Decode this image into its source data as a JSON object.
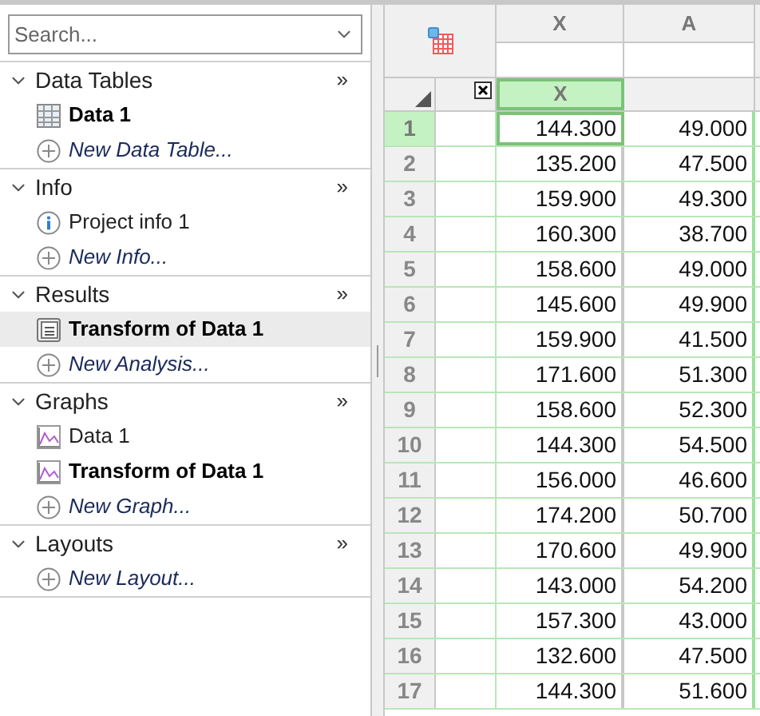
{
  "search": {
    "placeholder": "Search..."
  },
  "sections": [
    {
      "title": "Data Tables",
      "more": "»",
      "expanded": true,
      "items": [
        {
          "kind": "table",
          "label": "Data 1",
          "active": true,
          "selected": false
        },
        {
          "kind": "new",
          "label": "New Data Table...",
          "active": false,
          "selected": false
        }
      ]
    },
    {
      "title": "Info",
      "more": "»",
      "expanded": true,
      "items": [
        {
          "kind": "info",
          "label": "Project info 1",
          "active": false,
          "selected": false
        },
        {
          "kind": "new",
          "label": "New Info...",
          "active": false,
          "selected": false
        }
      ]
    },
    {
      "title": "Results",
      "more": "»",
      "expanded": true,
      "items": [
        {
          "kind": "result",
          "label": "Transform of Data 1",
          "active": true,
          "selected": true
        },
        {
          "kind": "new",
          "label": "New Analysis...",
          "active": false,
          "selected": false
        }
      ]
    },
    {
      "title": "Graphs",
      "more": "»",
      "expanded": true,
      "items": [
        {
          "kind": "graph",
          "label": "Data 1",
          "active": false,
          "selected": false
        },
        {
          "kind": "graph",
          "label": "Transform of Data 1",
          "active": true,
          "selected": false
        },
        {
          "kind": "new",
          "label": "New Graph...",
          "active": false,
          "selected": false
        }
      ]
    },
    {
      "title": "Layouts",
      "more": "»",
      "expanded": true,
      "items": [
        {
          "kind": "new",
          "label": "New Layout...",
          "active": false,
          "selected": false
        }
      ]
    }
  ],
  "grid": {
    "columns": [
      {
        "letter": "X",
        "title": "X",
        "selected": true
      },
      {
        "letter": "A",
        "selected": false
      }
    ],
    "rows": [
      {
        "num": "1",
        "selected": true,
        "cells": [
          "144.300",
          "49.000"
        ]
      },
      {
        "num": "2",
        "selected": false,
        "cells": [
          "135.200",
          "47.500"
        ]
      },
      {
        "num": "3",
        "selected": false,
        "cells": [
          "159.900",
          "49.300"
        ]
      },
      {
        "num": "4",
        "selected": false,
        "cells": [
          "160.300",
          "38.700"
        ]
      },
      {
        "num": "5",
        "selected": false,
        "cells": [
          "158.600",
          "49.000"
        ]
      },
      {
        "num": "6",
        "selected": false,
        "cells": [
          "145.600",
          "49.900"
        ]
      },
      {
        "num": "7",
        "selected": false,
        "cells": [
          "159.900",
          "41.500"
        ]
      },
      {
        "num": "8",
        "selected": false,
        "cells": [
          "171.600",
          "51.300"
        ]
      },
      {
        "num": "9",
        "selected": false,
        "cells": [
          "158.600",
          "52.300"
        ]
      },
      {
        "num": "10",
        "selected": false,
        "cells": [
          "144.300",
          "54.500"
        ]
      },
      {
        "num": "11",
        "selected": false,
        "cells": [
          "156.000",
          "46.600"
        ]
      },
      {
        "num": "12",
        "selected": false,
        "cells": [
          "174.200",
          "50.700"
        ]
      },
      {
        "num": "13",
        "selected": false,
        "cells": [
          "170.600",
          "49.900"
        ]
      },
      {
        "num": "14",
        "selected": false,
        "cells": [
          "143.000",
          "54.200"
        ]
      },
      {
        "num": "15",
        "selected": false,
        "cells": [
          "157.300",
          "43.000"
        ]
      },
      {
        "num": "16",
        "selected": false,
        "cells": [
          "132.600",
          "47.500"
        ]
      },
      {
        "num": "17",
        "selected": false,
        "cells": [
          "144.300",
          "51.600"
        ]
      }
    ]
  }
}
